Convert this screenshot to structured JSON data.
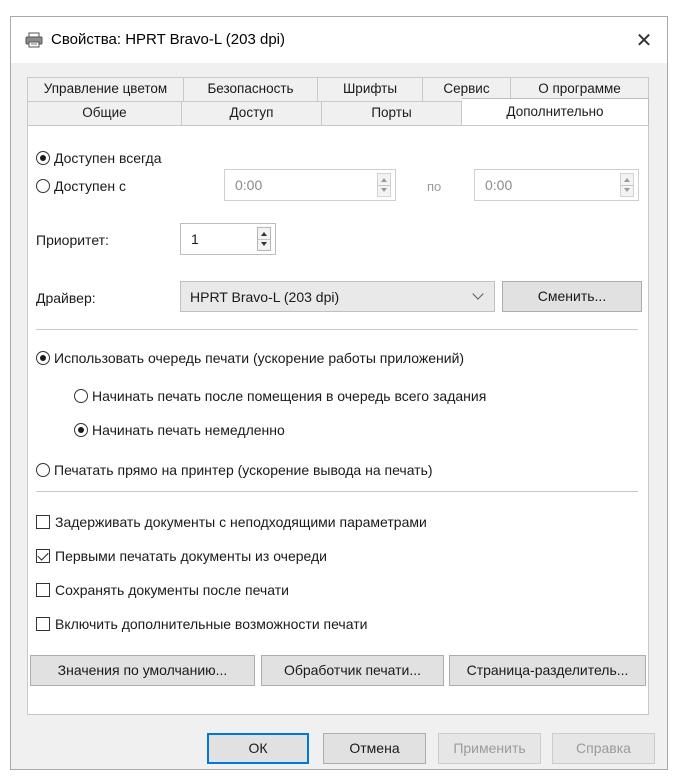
{
  "window": {
    "title": "Свойства: HPRT Bravo-L (203 dpi)",
    "close_glyph": "✕"
  },
  "tabs": {
    "back_row": [
      "Управление цветом",
      "Безопасность",
      "Шрифты",
      "Сервис",
      "О программе"
    ],
    "front_row": [
      "Общие",
      "Доступ",
      "Порты",
      "Дополнительно"
    ],
    "active": "Дополнительно"
  },
  "availability": {
    "always_label": "Доступен всегда",
    "from_label": "Доступен с",
    "from_value": "0:00",
    "to_label": "по",
    "to_value": "0:00",
    "selected": "always"
  },
  "priority": {
    "label": "Приоритет:",
    "value": "1"
  },
  "driver": {
    "label": "Драйвер:",
    "value": "HPRT Bravo-L (203 dpi)",
    "change_button": "Сменить..."
  },
  "spooling": {
    "use_spool_label": "Использовать очередь печати (ускорение работы приложений)",
    "start_after_label": "Начинать печать после помещения в очередь всего задания",
    "start_immediately_label": "Начинать печать немедленно",
    "direct_label": "Печатать прямо на принтер (ускорение вывода на печать)",
    "selected_mode": "spool",
    "selected_start": "immediately"
  },
  "options": [
    {
      "label": "Задерживать документы с неподходящими параметрами",
      "checked": false
    },
    {
      "label": "Первыми печатать документы из очереди",
      "checked": true
    },
    {
      "label": "Сохранять документы после печати",
      "checked": false
    },
    {
      "label": "Включить дополнительные возможности печати",
      "checked": false
    }
  ],
  "action_buttons": {
    "defaults": "Значения по умолчанию...",
    "processor": "Обработчик печати...",
    "separator_page": "Страница-разделитель..."
  },
  "dialog_buttons": {
    "ok": "ОК",
    "cancel": "Отмена",
    "apply": "Применить",
    "help": "Справка"
  },
  "colors": {
    "accent": "#0078d7",
    "panel_bg": "#ffffff",
    "window_bg": "#f0f0f0"
  }
}
